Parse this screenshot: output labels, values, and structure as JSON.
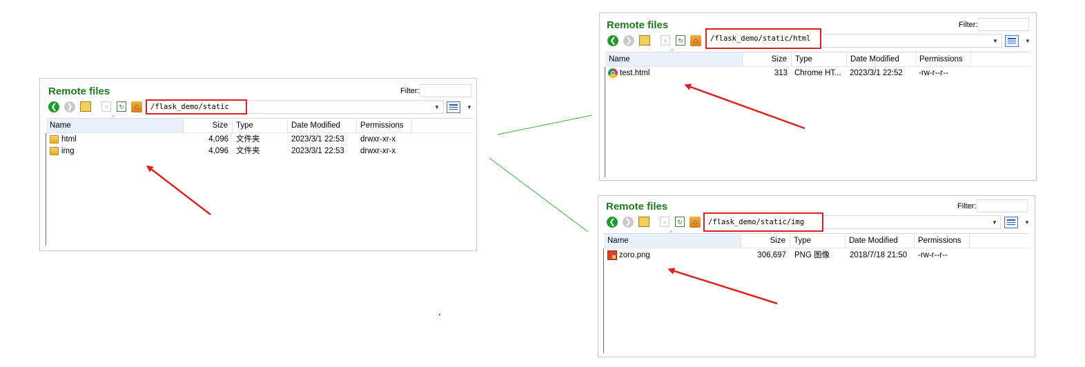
{
  "colors": {
    "title_green": "#1d7a1d",
    "highlight_red": "#e02020",
    "connector_green": "#2fb82f",
    "arrow_red": "#e02020"
  },
  "panels": [
    {
      "id": "static",
      "title": "Remote files",
      "filter_label": "Filter:",
      "path": "/flask_demo/static",
      "columns": [
        "Name",
        "Size",
        "Type",
        "Date Modified",
        "Permissions"
      ],
      "rows": [
        {
          "icon": "folder-icon",
          "name": "html",
          "size": "4,096",
          "type": "文件夹",
          "modified": "2023/3/1 22:53",
          "permissions": "drwxr-xr-x"
        },
        {
          "icon": "folder-icon",
          "name": "img",
          "size": "4,096",
          "type": "文件夹",
          "modified": "2023/3/1 22:53",
          "permissions": "drwxr-xr-x"
        }
      ]
    },
    {
      "id": "html",
      "title": "Remote files",
      "filter_label": "Filter:",
      "path": "/flask_demo/static/html",
      "columns": [
        "Name",
        "Size",
        "Type",
        "Date Modified",
        "Permissions"
      ],
      "rows": [
        {
          "icon": "chrome-icon",
          "name": "test.html",
          "size": "313",
          "type": "Chrome HT...",
          "modified": "2023/3/1 22:52",
          "permissions": "-rw-r--r--"
        }
      ]
    },
    {
      "id": "img",
      "title": "Remote files",
      "filter_label": "Filter:",
      "path": "/flask_demo/static/img",
      "columns": [
        "Name",
        "Size",
        "Type",
        "Date Modified",
        "Permissions"
      ],
      "rows": [
        {
          "icon": "png-image-icon",
          "name": "zoro.png",
          "size": "306,697",
          "type": "PNG 图像",
          "modified": "2018/7/18 21:50",
          "permissions": "-rw-r--r--"
        }
      ]
    }
  ]
}
